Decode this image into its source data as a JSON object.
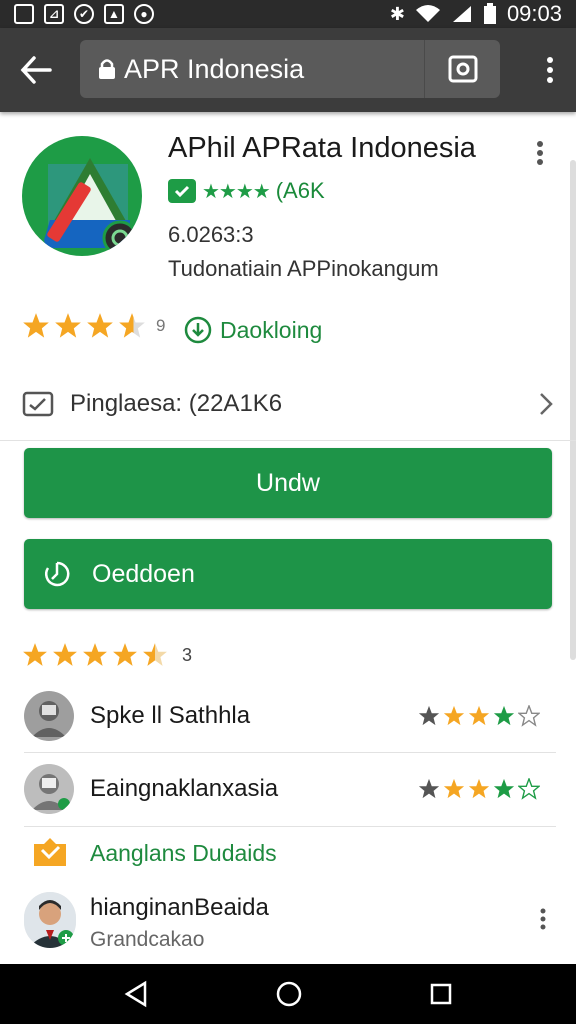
{
  "status_bar": {
    "time": "09:03",
    "left_icons": [
      "square-icon",
      "image-icon",
      "chat-icon",
      "gallery-icon",
      "circle-icon"
    ],
    "right_icons": [
      "bluetooth-icon",
      "wifi-icon",
      "signal-icon",
      "battery-icon"
    ]
  },
  "toolbar": {
    "url_text": "APR Indonesia"
  },
  "app": {
    "title": "APhil APRata Indonesia",
    "rating_badge_text": "(A6K",
    "version": "6.0263:3",
    "developer": "Tudonatiain APPinokangum",
    "star_rating": 3.5,
    "star_count": "9",
    "download_link": "Daokloing"
  },
  "package_row": {
    "label": "Pinglaesa: (22A1K6"
  },
  "buttons": {
    "primary": "Undw",
    "secondary": "Oeddoen"
  },
  "reviews_summary": {
    "star_rating": 4.5,
    "count": "3"
  },
  "reviews": [
    {
      "name": "Spke ll Sathhla",
      "stars": 4
    },
    {
      "name": "Eaingnaklanxasia",
      "stars": 4
    }
  ],
  "section": {
    "title": "Aanglans Dudaids"
  },
  "user": {
    "name": "hianginanBeaida",
    "subtitle": "Grandcakao"
  },
  "colors": {
    "accent_green": "#1e9448",
    "star_orange": "#f5a623",
    "toolbar_dark": "#3c3c3c"
  }
}
